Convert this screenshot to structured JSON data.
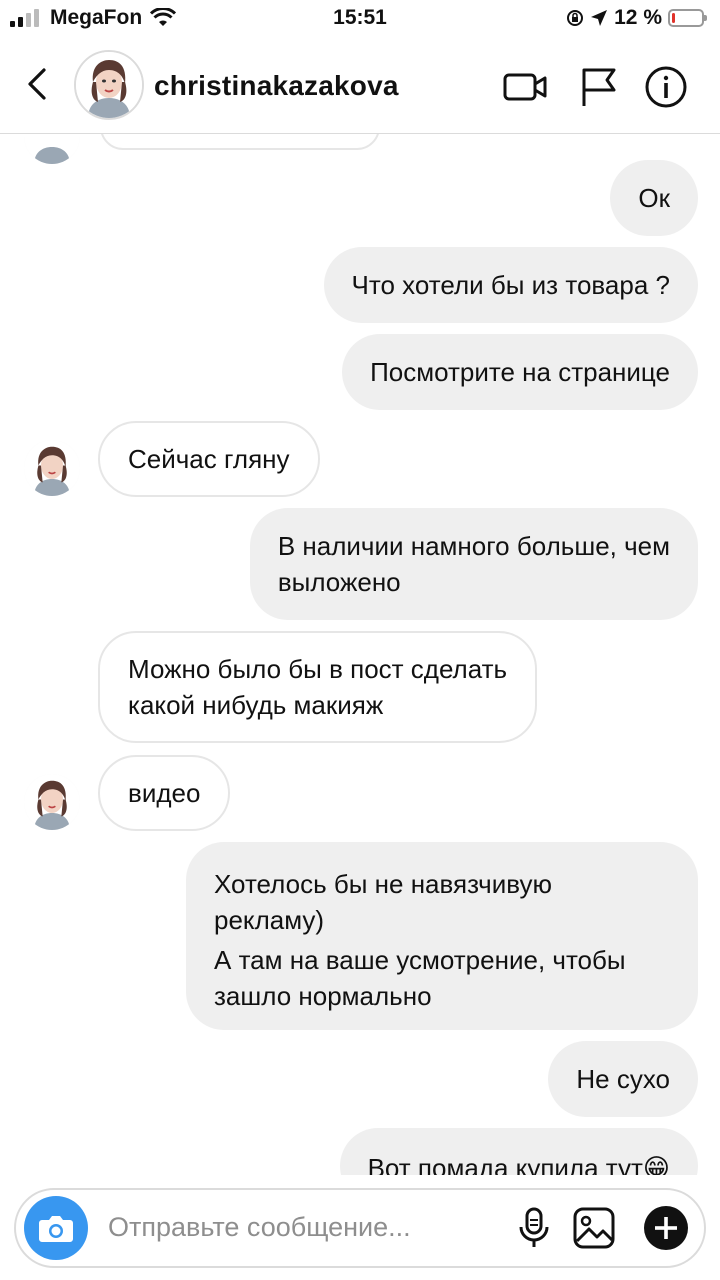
{
  "status_bar": {
    "carrier": "MegaFon",
    "time": "15:51",
    "battery": "12 %",
    "battery_level": 0.12
  },
  "header": {
    "username": "christinakazakova"
  },
  "messages": [
    {
      "from": "me",
      "lines": [
        "Ок"
      ]
    },
    {
      "from": "me",
      "lines": [
        "Что хотели бы из товара ?"
      ]
    },
    {
      "from": "me",
      "lines": [
        "Посмотрите на странице"
      ]
    },
    {
      "from": "them",
      "lines": [
        "Сейчас гляну"
      ]
    },
    {
      "from": "me",
      "lines": [
        "В наличии намного больше, чем",
        "выложено"
      ]
    },
    {
      "from": "them",
      "lines": [
        "Можно было бы в пост сделать",
        "какой нибудь макияж"
      ]
    },
    {
      "from": "them",
      "lines": [
        "видео"
      ]
    },
    {
      "from": "me",
      "lines": [
        "Хотелось бы не навязчивую",
        "рекламу)"
      ]
    },
    {
      "from": "me",
      "lines": [
        "А там на ваше усмотрение, чтобы",
        "зашло нормально"
      ]
    },
    {
      "from": "me",
      "lines": [
        "Не сухо"
      ]
    },
    {
      "from": "me",
      "lines": [
        "Вот помада купила тут😁"
      ]
    }
  ],
  "composer": {
    "placeholder": "Отправьте сообщение..."
  },
  "colors": {
    "outgoing_bubble": "#efefef",
    "accent": "#3897f0",
    "battery_low": "#e0332b"
  },
  "icons": [
    "back-icon",
    "video-call-icon",
    "flag-icon",
    "info-icon",
    "camera-icon",
    "microphone-icon",
    "gallery-icon",
    "plus-icon"
  ]
}
